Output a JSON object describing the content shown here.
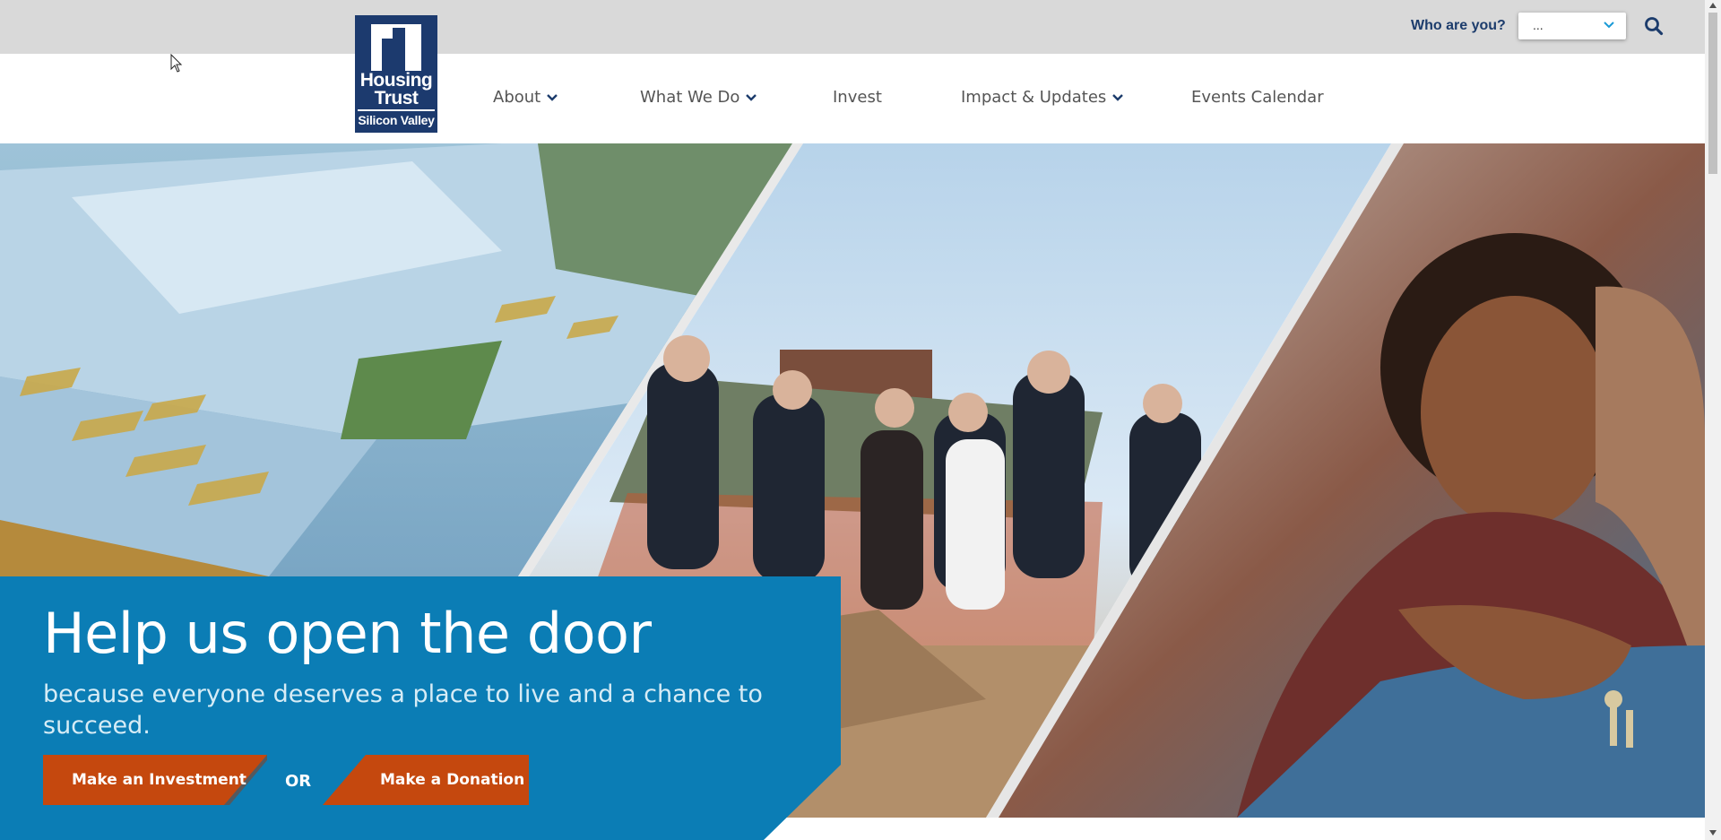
{
  "utility": {
    "who_label": "Who are you?",
    "who_select_value": "...",
    "search_icon": "search-icon"
  },
  "logo": {
    "line1": "Housing",
    "line2": "Trust",
    "line3": "Silicon Valley"
  },
  "nav": {
    "items": [
      {
        "label": "About",
        "has_dropdown": true
      },
      {
        "label": "What We Do",
        "has_dropdown": true
      },
      {
        "label": "Invest",
        "has_dropdown": false
      },
      {
        "label": "Impact & Updates",
        "has_dropdown": true
      },
      {
        "label": "Events Calendar",
        "has_dropdown": false
      }
    ]
  },
  "hero": {
    "headline": "Help us open the door",
    "subhead": "because everyone deserves a place to live and a chance to succeed.",
    "cta_invest": "Make an Investment",
    "or_label": "OR",
    "cta_donate": "Make a Donation"
  },
  "colors": {
    "brand_navy": "#1c3a6e",
    "hero_blue": "#0b7db5",
    "cta_orange": "#c5480e",
    "utility_gray": "#d9d9d9"
  }
}
